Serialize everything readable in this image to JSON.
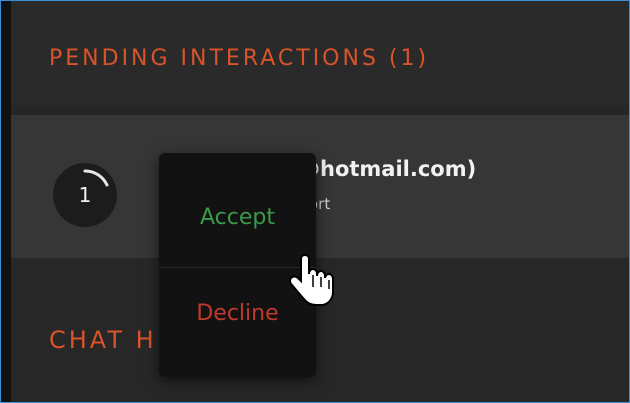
{
  "pending": {
    "title": "PENDING INTERACTIONS (1)",
    "item": {
      "count": "1",
      "name_fragment": "@hotmail.com)",
      "sub_fragment": "ort"
    }
  },
  "chat": {
    "title_fragment": "CHAT H"
  },
  "context_menu": {
    "accept_label": "Accept",
    "decline_label": "Decline"
  },
  "colors": {
    "accent": "#d9532b",
    "accept": "#3a9a4a",
    "decline": "#c0392b",
    "frame_border": "#3a8fd6"
  },
  "icons": {
    "cursor": "hand-pointer-icon",
    "progress": "progress-ring-icon"
  }
}
